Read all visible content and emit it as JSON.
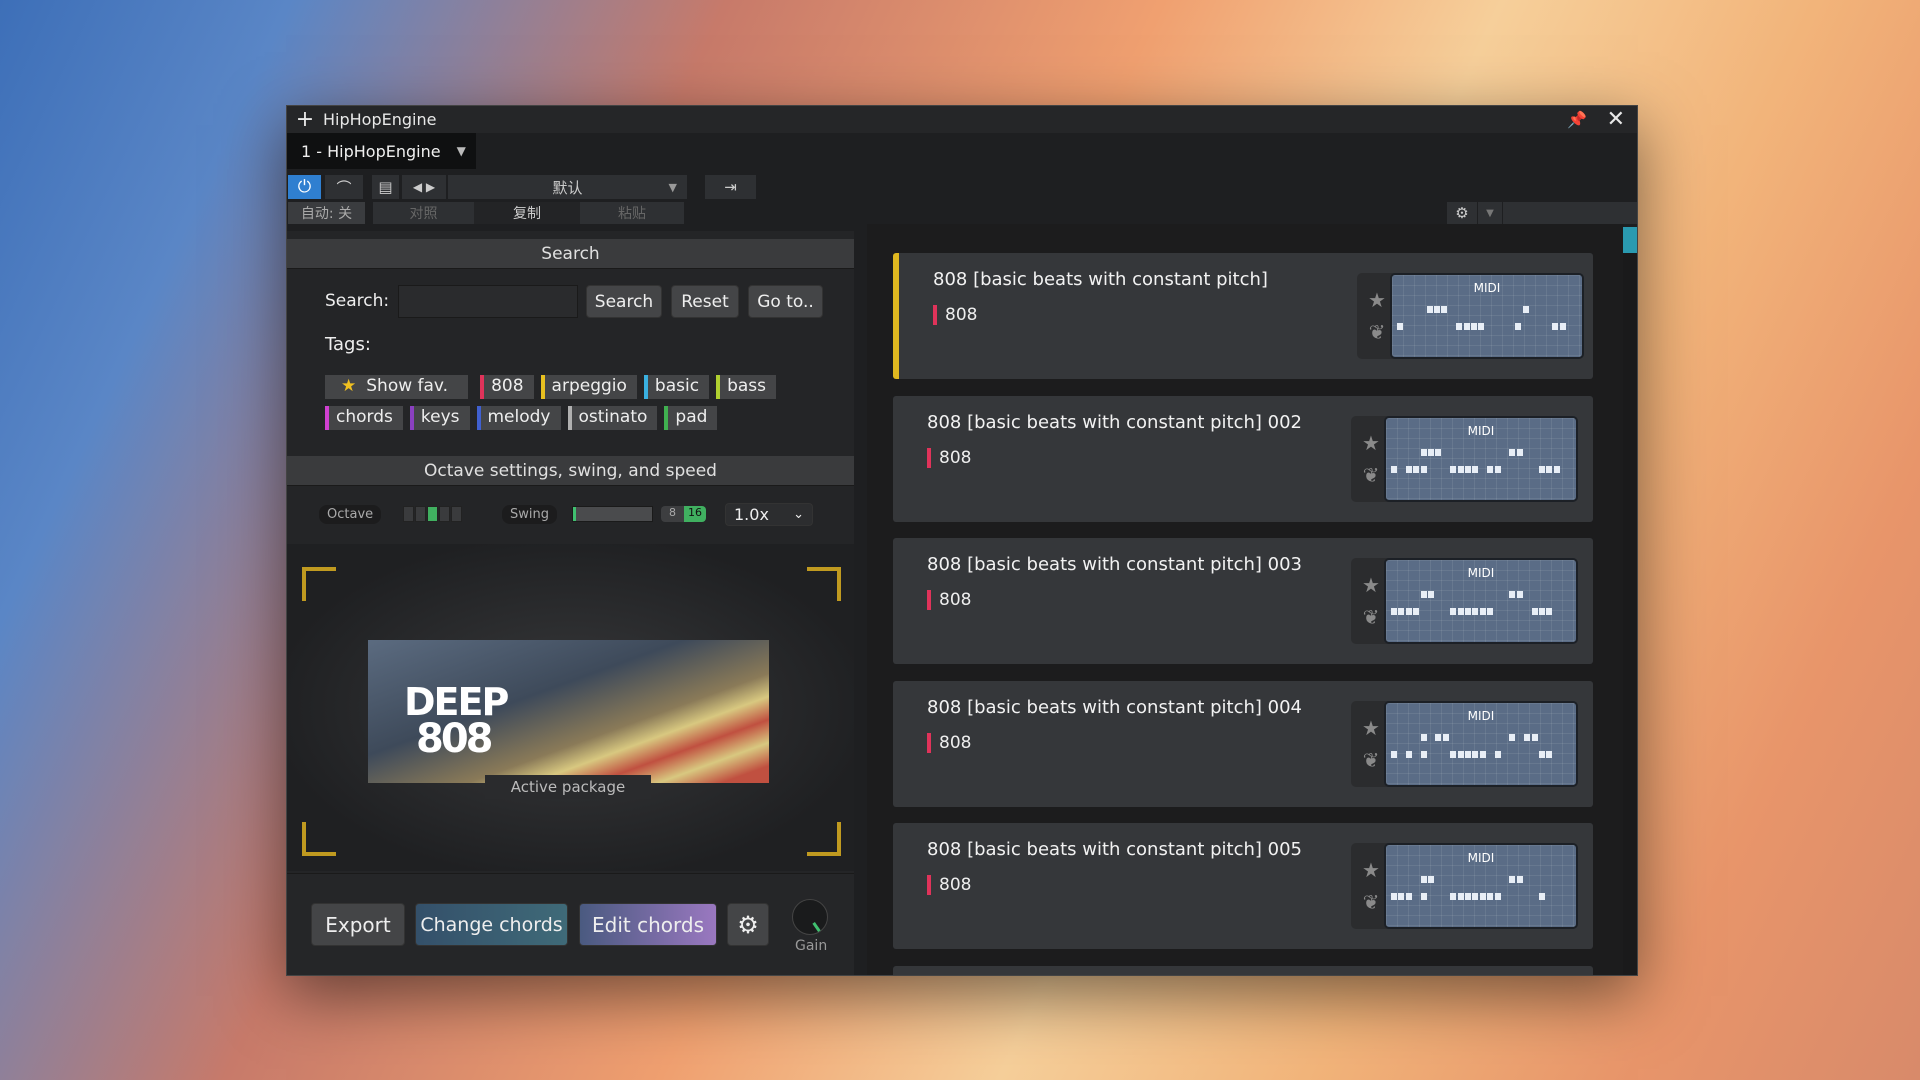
{
  "window": {
    "title": "HipHopEngine",
    "tab": "1 - HipHopEngine"
  },
  "toolbar": {
    "preset": "默认",
    "auto": "自动: 关",
    "compare": "对照",
    "copy": "复制",
    "paste": "粘贴"
  },
  "search": {
    "header": "Search",
    "label": "Search:",
    "value": "",
    "search_btn": "Search",
    "reset_btn": "Reset",
    "goto_btn": "Go to..",
    "tags_label": "Tags:",
    "show_fav": "Show fav.",
    "tags": [
      {
        "label": "808",
        "color": "#e0335a"
      },
      {
        "label": "arpeggio",
        "color": "#e8c020"
      },
      {
        "label": "basic",
        "color": "#3ab0e0"
      },
      {
        "label": "bass",
        "color": "#b0d030"
      },
      {
        "label": "chords",
        "color": "#d040d0"
      },
      {
        "label": "keys",
        "color": "#8a40c0"
      },
      {
        "label": "melody",
        "color": "#4060d0"
      },
      {
        "label": "ostinato",
        "color": "#b0b0b0"
      },
      {
        "label": "pad",
        "color": "#40b050"
      }
    ]
  },
  "settings": {
    "header": "Octave settings, swing, and speed",
    "octave_label": "Octave",
    "octave_selected": 3,
    "octave_steps": 5,
    "swing_label": "Swing",
    "swing_value": 0,
    "grid_8": "8",
    "grid_16": "16",
    "grid_selected": "16",
    "speed": "1.0x"
  },
  "package": {
    "logo_top": "DEEP",
    "logo_bottom": "808",
    "label": "Active package"
  },
  "bottom": {
    "export": "Export",
    "change_chords": "Change chords",
    "edit_chords": "Edit chords",
    "gain_label": "Gain"
  },
  "patterns": [
    {
      "title": "808 [basic beats with constant pitch]",
      "tag": "808",
      "selected": true,
      "rows": [
        "",
        "....###..........#......",
        "#.......####....#....##.",
        ""
      ]
    },
    {
      "title": "808 [basic beats with constant pitch] 002",
      "tag": "808",
      "selected": false,
      "rows": [
        "",
        "....###.........##......",
        "#.###...####.##.....###.",
        ""
      ]
    },
    {
      "title": "808 [basic beats with constant pitch] 003",
      "tag": "808",
      "selected": false,
      "rows": [
        "",
        "....##..........##......",
        "####....######.....###..",
        ""
      ]
    },
    {
      "title": "808 [basic beats with constant pitch] 004",
      "tag": "808",
      "selected": false,
      "rows": [
        "",
        "....#.##........#.##....",
        "#.#.#...#####.#.....##..",
        ""
      ]
    },
    {
      "title": "808 [basic beats with constant pitch] 005",
      "tag": "808",
      "selected": false,
      "rows": [
        "",
        "....##..........##......",
        "###.#...#######.....#...",
        ""
      ]
    }
  ]
}
